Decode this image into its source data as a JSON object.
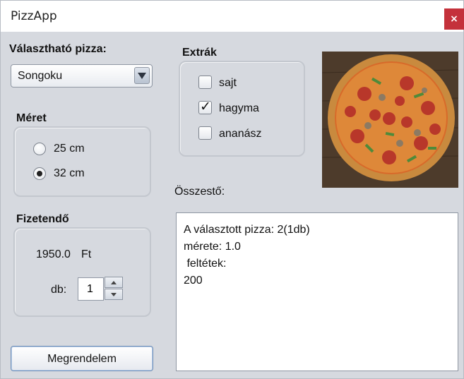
{
  "window": {
    "title": "PizzApp",
    "close_label": "×"
  },
  "pizza_select": {
    "label": "Választható pizza:",
    "selected": "Songoku"
  },
  "size": {
    "label": "Méret",
    "options": [
      "25 cm",
      "32 cm"
    ],
    "selected": "32 cm"
  },
  "extras": {
    "label": "Extrák",
    "items": [
      {
        "label": "sajt",
        "checked": false
      },
      {
        "label": "hagyma",
        "checked": true
      },
      {
        "label": "ananász",
        "checked": false
      }
    ]
  },
  "payment": {
    "label": "Fizetendő",
    "amount": "1950.0",
    "currency": "Ft",
    "qty_label": "db:",
    "qty_value": "1"
  },
  "summary": {
    "label": "Összestő:",
    "lines": [
      "A választott pizza: 2(1db)",
      "mérete: 1.0",
      " feltétek:",
      "200"
    ]
  },
  "order_button": {
    "label": "Megrendelem"
  },
  "icons": {
    "close": "close-icon",
    "dropdown": "chevron-down-icon",
    "spin_up": "arrow-up-icon",
    "spin_down": "arrow-down-icon",
    "check": "checkmark-icon"
  }
}
